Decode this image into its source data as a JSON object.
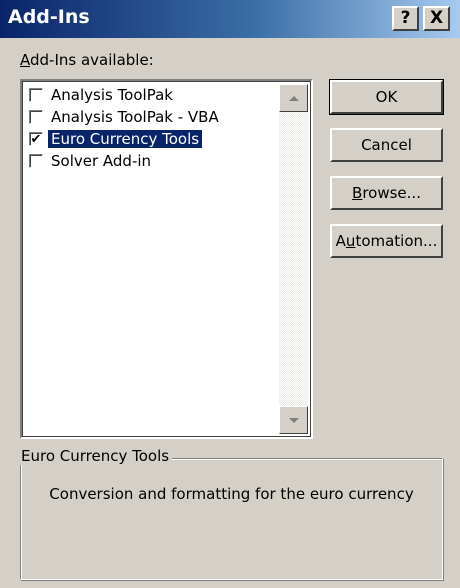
{
  "window": {
    "title": "Add-Ins",
    "help_glyph": "?",
    "close_glyph": "X"
  },
  "list": {
    "label_mnemonic": "A",
    "label_rest": "dd-Ins available:",
    "items": [
      {
        "label": "Analysis ToolPak",
        "checked": false,
        "selected": false
      },
      {
        "label": "Analysis ToolPak - VBA",
        "checked": false,
        "selected": false
      },
      {
        "label": "Euro Currency Tools",
        "checked": true,
        "selected": true
      },
      {
        "label": "Solver Add-in",
        "checked": false,
        "selected": false
      }
    ],
    "check_glyph": "✔"
  },
  "buttons": {
    "ok": "OK",
    "cancel": "Cancel",
    "browse_mnemonic": "B",
    "browse_rest": "rowse...",
    "automation_pre": "A",
    "automation_mnemonic": "u",
    "automation_rest": "tomation..."
  },
  "description": {
    "group_title": "Euro Currency Tools",
    "text": "Conversion and formatting for the euro currency"
  },
  "colors": {
    "face": "#d4d0c8",
    "title_start": "#0a246a",
    "title_end": "#a6caf0",
    "selection": "#0a246a"
  }
}
